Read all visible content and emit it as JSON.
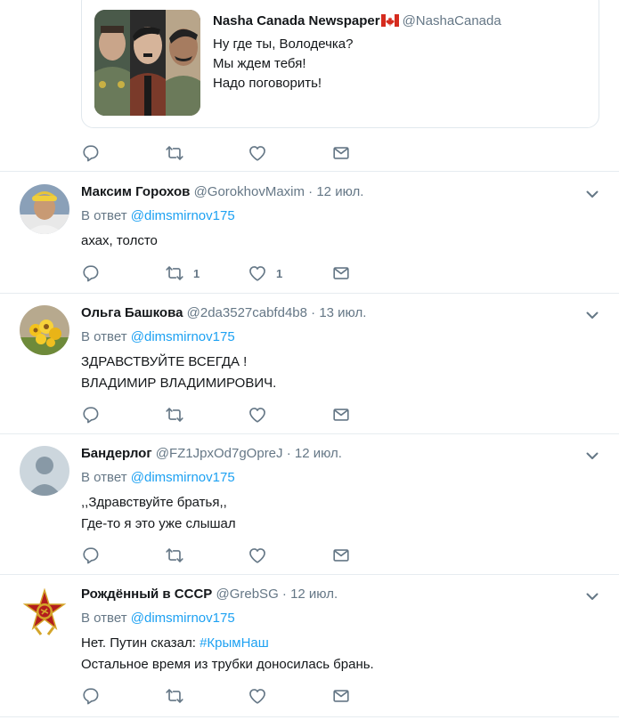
{
  "quoted_tweet": {
    "name": "Nasha Canada Newspaper",
    "handle": "@NashaCanada",
    "lines": [
      "Ну где ты, Володечка?",
      "Мы ждем тебя!",
      "Надо поговорить!"
    ]
  },
  "reply_prefix": "В ответ",
  "tweets": [
    {
      "name": "Максим Горохов",
      "handle": "@GorokhovMaxim",
      "separator": "·",
      "date": "12 июл.",
      "reply_to": "@dimsmirnov175",
      "lines": [
        "ахах, толсто"
      ],
      "retweets": "1",
      "likes": "1"
    },
    {
      "name": "Ольга Башкова",
      "handle": "@2da3527cabfd4b8",
      "separator": "·",
      "date": "13 июл.",
      "reply_to": "@dimsmirnov175",
      "lines": [
        "ЗДРАВСТВУЙТЕ ВСЕГДА !",
        "ВЛАДИМИР ВЛАДИМИРОВИЧ."
      ]
    },
    {
      "name": "Бандерлог",
      "handle": "@FZ1JpxOd7gOpreJ",
      "separator": "·",
      "date": "12 июл.",
      "reply_to": "@dimsmirnov175",
      "lines": [
        ",,Здравствуйте братья,,",
        "Где-то я это уже слышал"
      ]
    },
    {
      "name": "Рождённый в СССР",
      "handle": "@GrebSG",
      "separator": "·",
      "date": "12 июл.",
      "reply_to": "@dimsmirnov175",
      "line1_text": "Нет. Путин сказал: ",
      "line1_hashtag": "#КрымНаш",
      "line2": "Остальное время из трубки доносилась брань."
    }
  ],
  "colors": {
    "link": "#1da1f2",
    "secondary_text": "#657786",
    "icon": "#657786",
    "divider": "#e6ecf0"
  },
  "icons": {
    "reply": "reply-icon",
    "retweet": "retweet-icon",
    "like": "heart-icon",
    "message": "envelope-icon",
    "more": "chevron-down-icon"
  }
}
